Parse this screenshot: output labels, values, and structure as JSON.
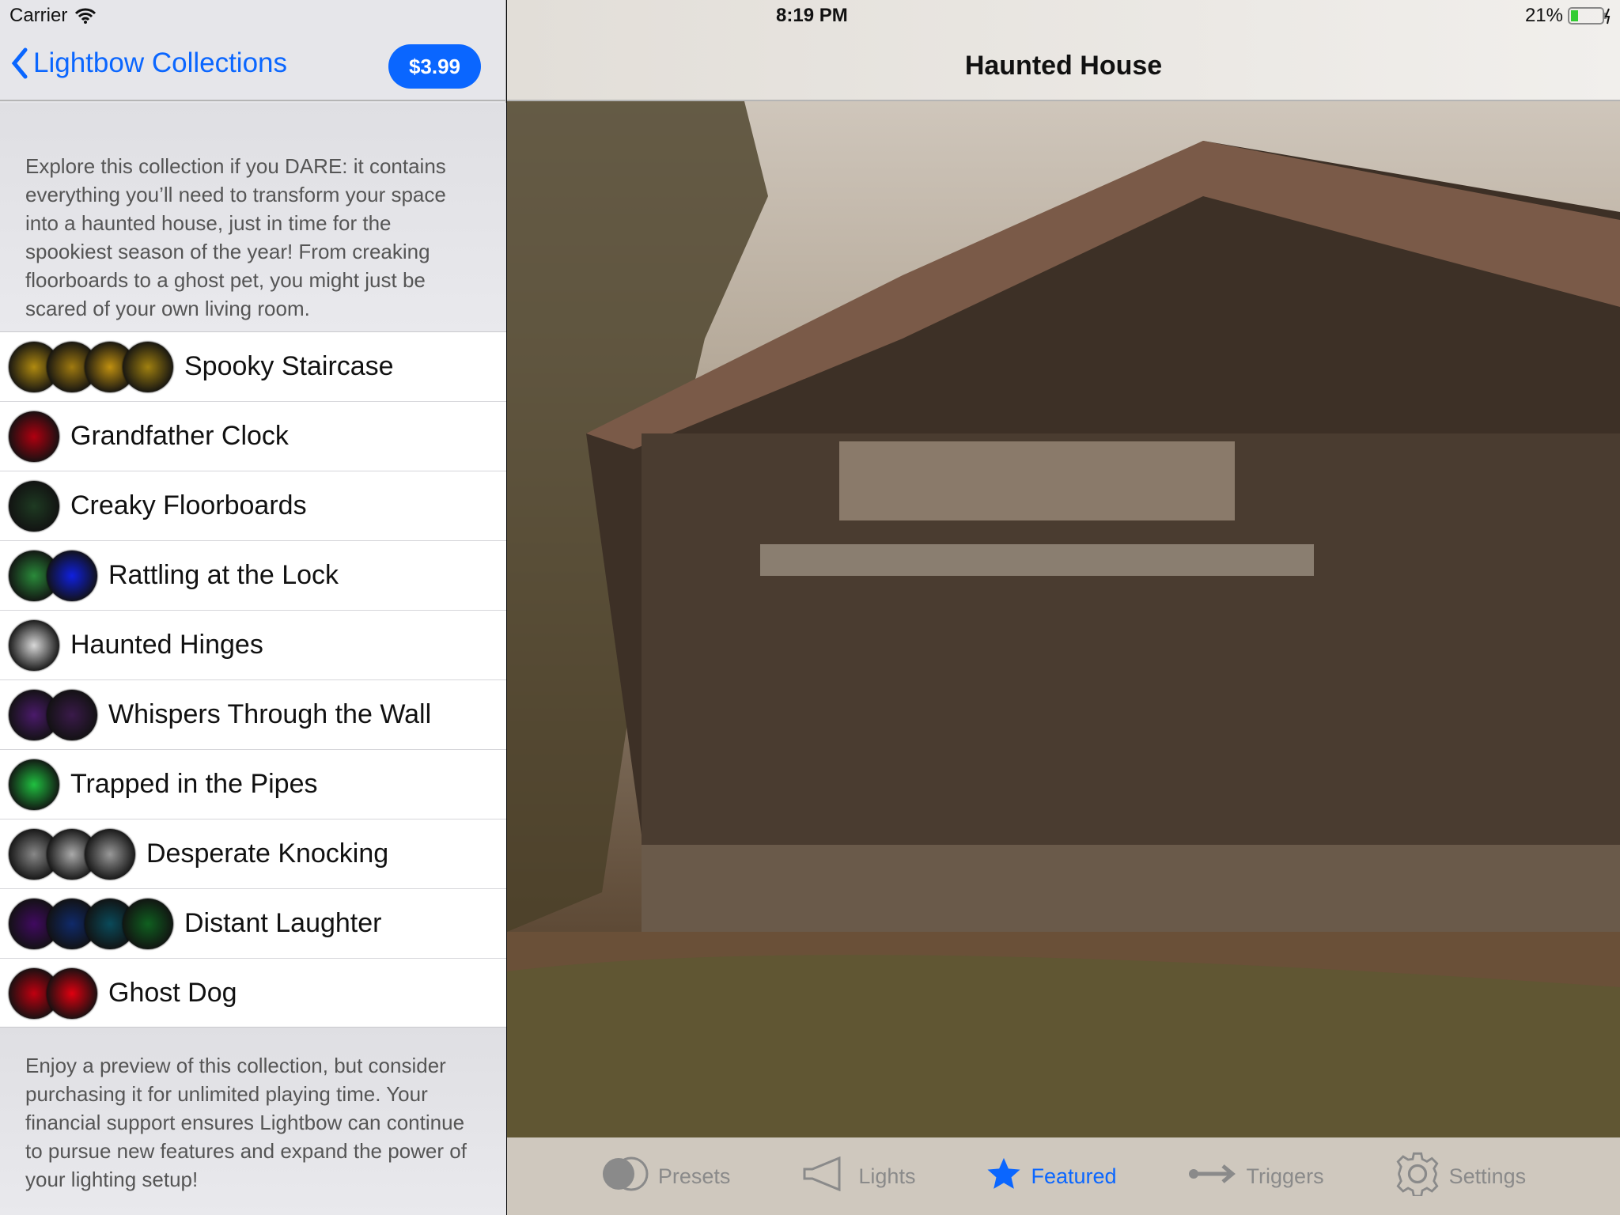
{
  "status": {
    "carrier": "Carrier",
    "time": "8:19 PM",
    "battery": "21%"
  },
  "nav": {
    "back_label": "Lightbow Collections",
    "price": "$3.99",
    "title": "Haunted House"
  },
  "description": "Explore this collection if you DARE: it contains everything you’ll need to transform your space into a haunted house, just in time for the spookiest season of the year! From creaking floorboards to a ghost pet, you might just be scared of your own living room.",
  "footer": "Enjoy a preview of this collection, but consider purchasing it for unlimited playing time. Your financial support ensures Lightbow can continue to pursue new features and expand the power of your lighting setup!",
  "items": [
    {
      "label": "Spooky Staircase",
      "colors": [
        "#b08a10",
        "#a07a10",
        "#c09010",
        "#a08010"
      ]
    },
    {
      "label": "Grandfather Clock",
      "colors": [
        "#b00010"
      ]
    },
    {
      "label": "Creaky Floorboards",
      "colors": [
        "#1e3a22"
      ]
    },
    {
      "label": "Rattling at the Lock",
      "colors": [
        "#2a8a3a",
        "#1020e0"
      ]
    },
    {
      "label": "Haunted Hinges",
      "colors": [
        "#d8d8d8"
      ]
    },
    {
      "label": "Whispers Through the Wall",
      "colors": [
        "#4a1a6a",
        "#3a1a4a"
      ]
    },
    {
      "label": "Trapped in the Pipes",
      "colors": [
        "#20c040"
      ]
    },
    {
      "label": "Desperate Knocking",
      "colors": [
        "#888888",
        "#aaaaaa",
        "#999999"
      ]
    },
    {
      "label": "Distant Laughter",
      "colors": [
        "#400a60",
        "#102a6a",
        "#0a4a5a",
        "#106020"
      ]
    },
    {
      "label": "Ghost Dog",
      "colors": [
        "#c00010",
        "#e00010"
      ]
    }
  ],
  "tabs": [
    {
      "label": "Presets",
      "icon": "toggle-icon"
    },
    {
      "label": "Lights",
      "icon": "bulb-icon"
    },
    {
      "label": "Featured",
      "icon": "star-icon",
      "active": true
    },
    {
      "label": "Triggers",
      "icon": "arrow-icon"
    },
    {
      "label": "Settings",
      "icon": "gear-icon"
    }
  ],
  "colors": {
    "accent": "#0a66ff"
  }
}
